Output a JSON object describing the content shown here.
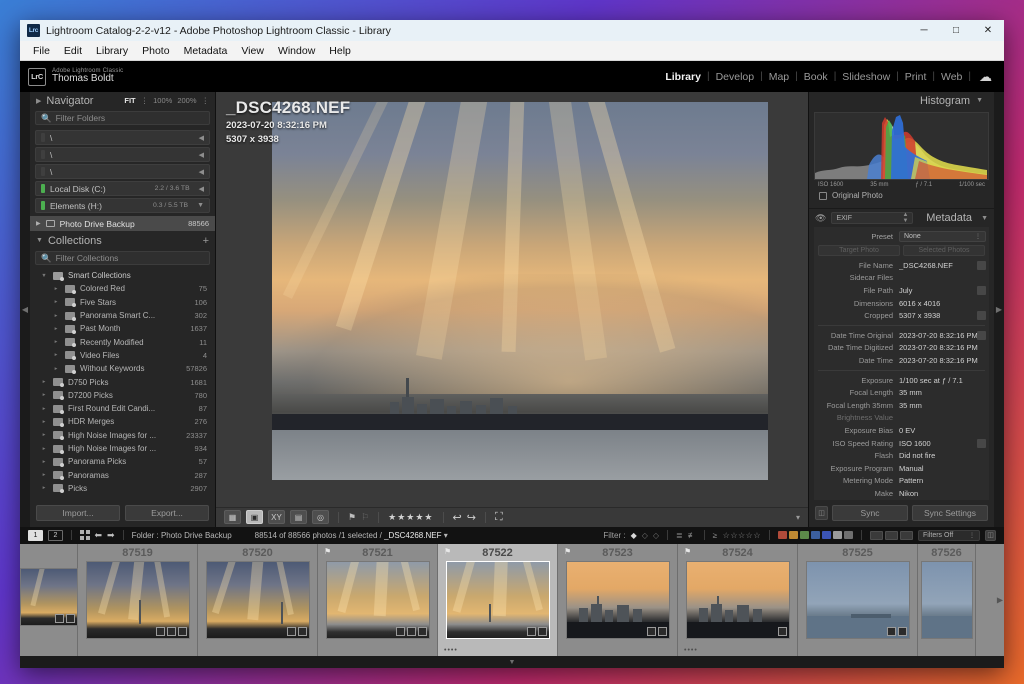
{
  "window": {
    "title": "Lightroom Catalog-2-2-v12 - Adobe Photoshop Lightroom Classic - Library",
    "app_icon_label": "Lrc",
    "minimize": "─",
    "maximize": "□",
    "close": "✕"
  },
  "menubar": [
    "File",
    "Edit",
    "Library",
    "Photo",
    "Metadata",
    "View",
    "Window",
    "Help"
  ],
  "identity": {
    "logo": "LrC",
    "line1": "Adobe Lightroom Classic",
    "line2": "Thomas Boldt"
  },
  "modules": [
    {
      "label": "Library",
      "active": true
    },
    {
      "label": "Develop",
      "active": false
    },
    {
      "label": "Map",
      "active": false
    },
    {
      "label": "Book",
      "active": false
    },
    {
      "label": "Slideshow",
      "active": false
    },
    {
      "label": "Print",
      "active": false
    },
    {
      "label": "Web",
      "active": false
    }
  ],
  "navigator": {
    "title": "Navigator",
    "fit": "FIT",
    "zoom_100": "100%",
    "zoom_200": "200%"
  },
  "folders": {
    "filter_placeholder": "Filter Folders",
    "volumes": [
      {
        "name": "\\",
        "space": "",
        "led": "grey"
      },
      {
        "name": "\\",
        "space": "",
        "led": "grey"
      },
      {
        "name": "\\",
        "space": "",
        "led": "grey"
      },
      {
        "name": "Local Disk (C:)",
        "space": "2.2 / 3.6 TB",
        "led": "green"
      },
      {
        "name": "Elements (H:)",
        "space": "0.3 / 5.5 TB",
        "led": "green"
      }
    ],
    "selected_folder": {
      "name": "Photo Drive Backup",
      "count": "88566"
    }
  },
  "collections": {
    "title": "Collections",
    "filter_placeholder": "Filter Collections",
    "smart_header": "Smart Collections",
    "smart_items": [
      {
        "label": "Colored Red",
        "count": "75"
      },
      {
        "label": "Five Stars",
        "count": "106"
      },
      {
        "label": "Panorama Smart C...",
        "count": "302"
      },
      {
        "label": "Past Month",
        "count": "1637"
      },
      {
        "label": "Recently Modified",
        "count": "11"
      },
      {
        "label": "Video Files",
        "count": "4"
      },
      {
        "label": "Without Keywords",
        "count": "57826"
      }
    ],
    "items": [
      {
        "label": "D750 Picks",
        "count": "1681"
      },
      {
        "label": "D7200 Picks",
        "count": "780"
      },
      {
        "label": "First Round Edit Candi...",
        "count": "87"
      },
      {
        "label": "HDR Merges",
        "count": "276"
      },
      {
        "label": "High Noise Images for ...",
        "count": "23337"
      },
      {
        "label": "High Noise Images for ...",
        "count": "934"
      },
      {
        "label": "Panorama Picks",
        "count": "57"
      },
      {
        "label": "Panoramas",
        "count": "287"
      },
      {
        "label": "Picks",
        "count": "2907"
      }
    ]
  },
  "left_buttons": {
    "import": "Import...",
    "export": "Export..."
  },
  "photo_overlay": {
    "filename": "_DSC4268.NEF",
    "datetime": "2023-07-20 8:32:16 PM",
    "dimensions": "5307 x 3938"
  },
  "toolbar": {
    "views": [
      {
        "name": "grid-view",
        "glyph": "▦",
        "active": false
      },
      {
        "name": "loupe-view",
        "glyph": "▣",
        "active": true
      },
      {
        "name": "compare-view",
        "glyph": "XY",
        "active": false
      },
      {
        "name": "survey-view",
        "glyph": "▤",
        "active": false
      },
      {
        "name": "people-view",
        "glyph": "◎",
        "active": false
      }
    ],
    "flag_set": "⚑",
    "flag_unset": "⚐",
    "stars": "★★★★★",
    "rotate_left": "↩",
    "rotate_right": "↪",
    "crop_overlay": "⛶",
    "caret": "▾"
  },
  "histogram": {
    "title": "Histogram",
    "iso": "ISO 1600",
    "focal": "35 mm",
    "aperture": "ƒ / 7.1",
    "shutter": "1/100 sec",
    "original_photo": "Original Photo"
  },
  "metadata": {
    "title": "Metadata",
    "view_select": "EXIF",
    "preset_label": "Preset",
    "preset_value": "None",
    "target_photo": "Target Photo",
    "selected_photos": "Selected Photos",
    "group1": [
      {
        "key": "File Name",
        "value": "_DSC4268.NEF",
        "button": true
      },
      {
        "key": "Sidecar Files",
        "value": "",
        "button": false
      },
      {
        "key": "File Path",
        "value": "July",
        "button": true
      },
      {
        "key": "Dimensions",
        "value": "6016 x 4016",
        "button": false
      },
      {
        "key": "Cropped",
        "value": "5307 x 3938",
        "button": true
      }
    ],
    "group2": [
      {
        "key": "Date Time Original",
        "value": "2023-07-20 8:32:16 PM",
        "button": true
      },
      {
        "key": "Date Time Digitized",
        "value": "2023-07-20 8:32:16 PM",
        "button": false
      },
      {
        "key": "Date Time",
        "value": "2023-07-20 8:32:16 PM",
        "button": false
      }
    ],
    "group3": [
      {
        "key": "Exposure",
        "value": "1/100 sec at ƒ / 7.1",
        "button": false
      },
      {
        "key": "Focal Length",
        "value": "35 mm",
        "button": false
      },
      {
        "key": "Focal Length 35mm",
        "value": "35 mm",
        "button": false
      },
      {
        "key": "Brightness Value",
        "value": "",
        "button": false
      },
      {
        "key": "Exposure Bias",
        "value": "0 EV",
        "button": false
      },
      {
        "key": "ISO Speed Rating",
        "value": "ISO 1600",
        "button": true
      },
      {
        "key": "Flash",
        "value": "Did not fire",
        "button": false
      },
      {
        "key": "Exposure Program",
        "value": "Manual",
        "button": false
      },
      {
        "key": "Metering Mode",
        "value": "Pattern",
        "button": false
      },
      {
        "key": "Make",
        "value": "Nikon",
        "button": false
      }
    ]
  },
  "right_buttons": {
    "sync": "Sync",
    "sync_settings": "Sync Settings"
  },
  "filmstrip_bar": {
    "screen1": "1",
    "screen2": "2",
    "source_label": "Folder : Photo Drive Backup",
    "count_text": "88514 of 88566 photos /1 selected /",
    "selected_file": "_DSC4268.NEF",
    "caret": "▾",
    "filter_label": "Filter :",
    "stars": "☆☆☆☆☆",
    "compare_op": "≥",
    "filters_off": "Filters Off",
    "color_swatches": [
      "#b14b3a",
      "#c08a33",
      "#5d8a4a",
      "#3c5f9e",
      "#3b54b5",
      "#9a9a9a",
      "#6e6e6e"
    ]
  },
  "filmstrip": [
    {
      "num": "87519",
      "flag": false,
      "selected": false,
      "scene": "sc-a",
      "dots": "",
      "badges": 3
    },
    {
      "num": "87520",
      "flag": false,
      "selected": false,
      "scene": "sc-a",
      "dots": "",
      "badges": 2
    },
    {
      "num": "87521",
      "flag": true,
      "selected": false,
      "scene": "sc-b",
      "dots": "",
      "badges": 3
    },
    {
      "num": "87522",
      "flag": true,
      "selected": true,
      "scene": "sc-b",
      "dots": "••••",
      "badges": 2
    },
    {
      "num": "87523",
      "flag": true,
      "selected": false,
      "scene": "sc-c",
      "dots": "",
      "badges": 2
    },
    {
      "num": "87524",
      "flag": true,
      "selected": false,
      "scene": "sc-c",
      "dots": "••••",
      "badges": 1
    },
    {
      "num": "87525",
      "flag": false,
      "selected": false,
      "scene": "sc-d",
      "dots": "",
      "badges": 2
    },
    {
      "num": "87526",
      "flag": false,
      "selected": false,
      "scene": "sc-d",
      "dots": "",
      "badges": 0
    }
  ]
}
